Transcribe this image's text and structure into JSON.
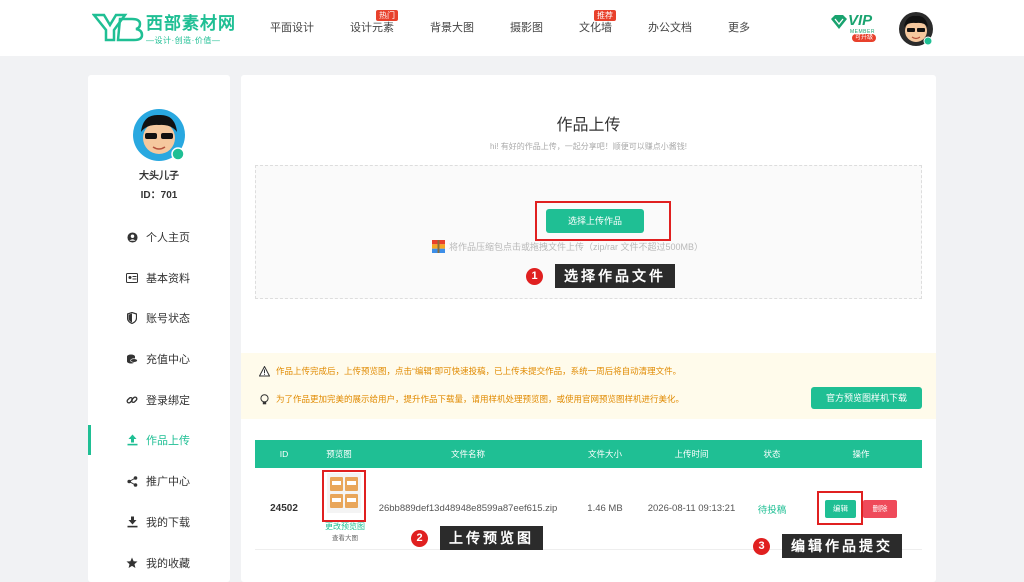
{
  "brand": {
    "title": "西部素材网",
    "slogan": "—设计·创造·价值—",
    "primary_color": "#1fbf94",
    "alert_color": "#e02020"
  },
  "nav": [
    {
      "label": "平面设计",
      "badge": ""
    },
    {
      "label": "设计元素",
      "badge": "热门"
    },
    {
      "label": "背景大图",
      "badge": ""
    },
    {
      "label": "摄影图",
      "badge": ""
    },
    {
      "label": "文化墙",
      "badge": "推荐"
    },
    {
      "label": "办公文档",
      "badge": ""
    },
    {
      "label": "更多",
      "badge": ""
    }
  ],
  "vip": {
    "label": "VIP",
    "member": "MEMBER",
    "sub": "可升级"
  },
  "user": {
    "name": "大头儿子",
    "id_text": "ID：701"
  },
  "menu": [
    {
      "label": "个人主页",
      "icon": "user-icon"
    },
    {
      "label": "基本资料",
      "icon": "id-card-icon"
    },
    {
      "label": "账号状态",
      "icon": "shield-icon"
    },
    {
      "label": "充值中心",
      "icon": "coins-icon"
    },
    {
      "label": "登录绑定",
      "icon": "link-icon"
    },
    {
      "label": "作品上传",
      "icon": "upload-icon",
      "active": true
    },
    {
      "label": "推广中心",
      "icon": "share-icon"
    },
    {
      "label": "我的下载",
      "icon": "download-icon"
    },
    {
      "label": "我的收藏",
      "icon": "star-icon"
    }
  ],
  "upload": {
    "title": "作品上传",
    "subtitle": "hi! 有好的作品上传，一起分享吧！顺便可以赚点小酱钱!",
    "button": "选择上传作品",
    "hint": "将作品压缩包点击或拖拽文件上传（zip/rar 文件不超过500MB）"
  },
  "steps": [
    {
      "num": "1",
      "label": "选择作品文件"
    },
    {
      "num": "2",
      "label": "上传预览图"
    },
    {
      "num": "3",
      "label": "编辑作品提交"
    }
  ],
  "notice": {
    "line1": "作品上传完成后，上传预览图，点击“编辑”即可快速投稿，已上传未提交作品，系统一周后将自动清理文件。",
    "line2": "为了作品更加完美的展示给用户，提升作品下载量，请用样机处理预览图，或使用官网预览图样机进行美化。",
    "button": "官方预览图样机下载"
  },
  "table": {
    "headers": [
      "ID",
      "预览图",
      "文件名称",
      "文件大小",
      "上传时间",
      "状态",
      "操作"
    ],
    "rows": [
      {
        "id": "24502",
        "preview_link": "更改预览图",
        "preview_view": "查看大图",
        "filename": "26bb889def13d48948e8599a87eef615.zip",
        "size": "1.46 MB",
        "time": "2026-08-11 09:13:21",
        "status": "待投稿",
        "edit": "编辑",
        "delete": "删除"
      }
    ]
  }
}
